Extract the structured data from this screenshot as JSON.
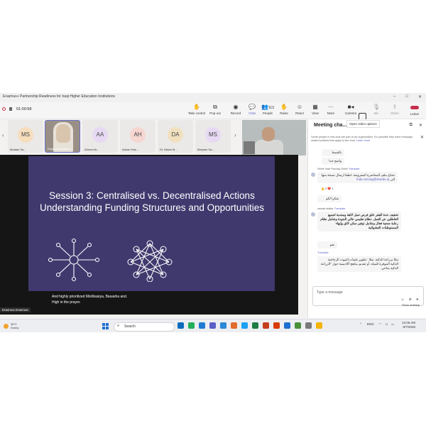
{
  "window": {
    "title": "Erasmus+ Partnership Readiness for Iraqi Higher Education Institutions",
    "controls": [
      "–",
      "□",
      "✕"
    ]
  },
  "call": {
    "timer": "01:00:58"
  },
  "toolbar": {
    "take_control": "Take control",
    "pop_out": "Pop out",
    "record": "Record",
    "chat": "Chat",
    "people": "People",
    "people_count": "113",
    "raise": "Raise",
    "react": "React",
    "view": "View",
    "more": "More",
    "camera": "Camera",
    "mic": "Mic",
    "share": "Share",
    "leave": "Leave",
    "tooltip": "Open video options"
  },
  "gallery": {
    "participants": [
      {
        "initials": "MS",
        "name": "Moataz Sa...",
        "color": "#f6ddbd"
      },
      {
        "initials": "",
        "name": "Erasmus Erasmus",
        "color": "#9a8f86"
      },
      {
        "initials": "AA",
        "name": "Ahmed Al...",
        "color": "#e7d9f3"
      },
      {
        "initials": "AH",
        "name": "Adnan Has...",
        "color": "#f5d6d0"
      },
      {
        "initials": "DA",
        "name": "Dr. Mazin M...",
        "color": "#f1e0bf"
      },
      {
        "initials": "MS",
        "name": "Maryam Sa...",
        "color": "#e7d9f3"
      }
    ]
  },
  "slide": {
    "title": "Session 3: Centralised vs. Decentralised Actions Understanding Funding Structures and Opportunities",
    "caption_line1": "And highly prioritized Mishbasiya, Basasha and.",
    "caption_line2": "High in the prayer.",
    "presenter_badge": "Erasmus Erasmus"
  },
  "chat": {
    "header": "Meeting cha...",
    "notice": "Some people in this chat are part of an organization. It's possible they have message-related policies that apply to the chat.",
    "learn_more": "Learn more",
    "messages": [
      {
        "text": "بالضبط"
      },
      {
        "text": "واضح جدا"
      },
      {
        "sender": "Seble Ihab Razzaq Sebhi",
        "translate": "Translate",
        "text": "نحتاج ملف المحاضرة المعروضة ،لطفا ارسال نسخة منها الى"
      },
      {
        "link": "ihab.razzaq@stuedu.iq"
      },
      {
        "reactions": "👍 2   ❤️ 1"
      },
      {
        "text": "شكرا لكم"
      },
      {
        "sender": "zainab alattar",
        "translate": "Translate",
        "text": "تخفيف حدة الفقر خلق فرص عمل لائقة ومجدية لجميع العاطلين عن العمل ،نظام تعليمي عالي الجودة وشامل نظام رعاية صحية فعال وشامل توفير سكن لائق وإنهاء المستوطنات العشوائية"
      },
      {
        "text": "نعم"
      },
      {
        "translate": "Translate"
      },
      {
        "text": "مثلا برزاعة الذكية. مثلا : تطوير تقنيات البيوت الزجاجية الذكية الموفرة للمياه. أو تقديم مناهج أكاديمية حول \"الزراعة الذكية مناخي"
      }
    ],
    "compose_placeholder": "Type a message",
    "show_desktop": "Show desktop"
  },
  "taskbar": {
    "temperature": "36°C",
    "condition": "Sunny",
    "search": "Search",
    "lang": "ENG",
    "time": "12:06 AM",
    "date": "6/7/2026",
    "app_colors": [
      "#0f6cbd",
      "#23b05b",
      "#1f7ad1",
      "#5b5fc7",
      "#2b88d8",
      "#e26b2e",
      "#1da1f2",
      "#1d7b44",
      "#c43e1c",
      "#d83b01",
      "#1f6fd1",
      "#4a8f3a",
      "#7a7a7a",
      "#f4b400"
    ]
  }
}
